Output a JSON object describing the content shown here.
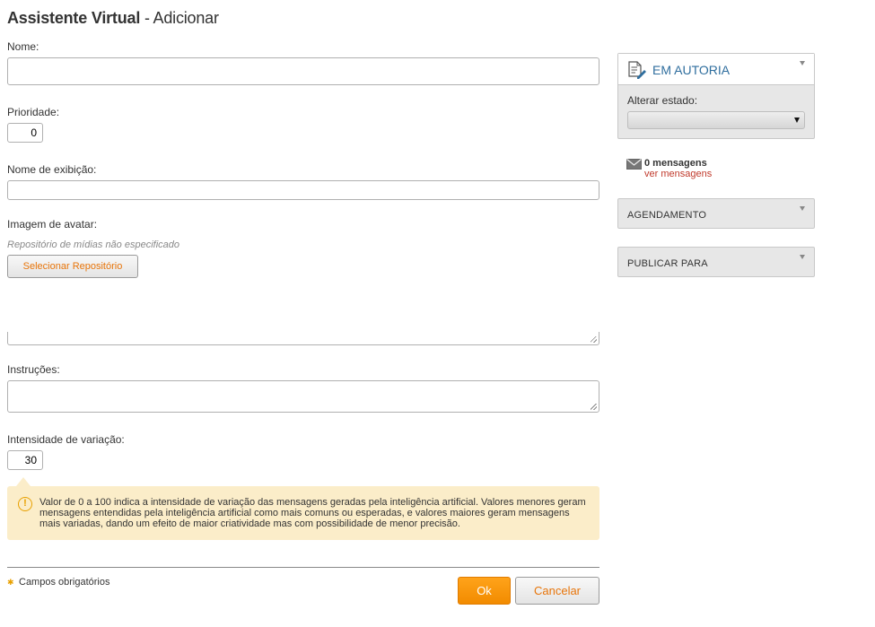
{
  "header": {
    "title_strong": "Assistente Virtual",
    "title_rest": " - Adicionar"
  },
  "form": {
    "name_label": "Nome:",
    "name_value": "",
    "priority_label": "Prioridade:",
    "priority_value": "0",
    "display_name_label": "Nome de exibição:",
    "display_name_value": "",
    "avatar_label": "Imagem de avatar:",
    "avatar_repo_note": "Repositório de mídias não especificado",
    "select_repo_label": "Selecionar Repositório",
    "instructions_label": "Instruções:",
    "instructions_value": "",
    "variation_label": "Intensidade de variação:",
    "variation_value": "30",
    "variation_hint": "Valor de 0 a 100 indica a intensidade de variação das mensagens geradas pela inteligência artificial. Valores menores geram mensagens entendidas pela inteligência artificial como mais comuns ou esperadas, e valores maiores geram mensagens mais variadas, dando um efeito de maior criatividade mas com possibilidade de menor precisão.",
    "required_note": "Campos obrigatórios",
    "ok_label": "Ok",
    "cancel_label": "Cancelar"
  },
  "sidebar": {
    "authoring": {
      "title": "EM AUTORIA",
      "change_state_label": "Alterar estado:",
      "state_value": ""
    },
    "messages": {
      "count_label": "0 mensagens",
      "link_label": "ver mensagens"
    },
    "panels": [
      {
        "title": "AGENDAMENTO"
      },
      {
        "title": "PUBLICAR PARA"
      }
    ]
  },
  "colors": {
    "accent": "#f28b00",
    "link": "#c0392b",
    "title_blue": "#2f6e9e",
    "hint_bg": "#fbedc9"
  },
  "icons": [
    "edit-document-icon",
    "envelope-icon",
    "warning-icon",
    "chevron-down-icon"
  ]
}
